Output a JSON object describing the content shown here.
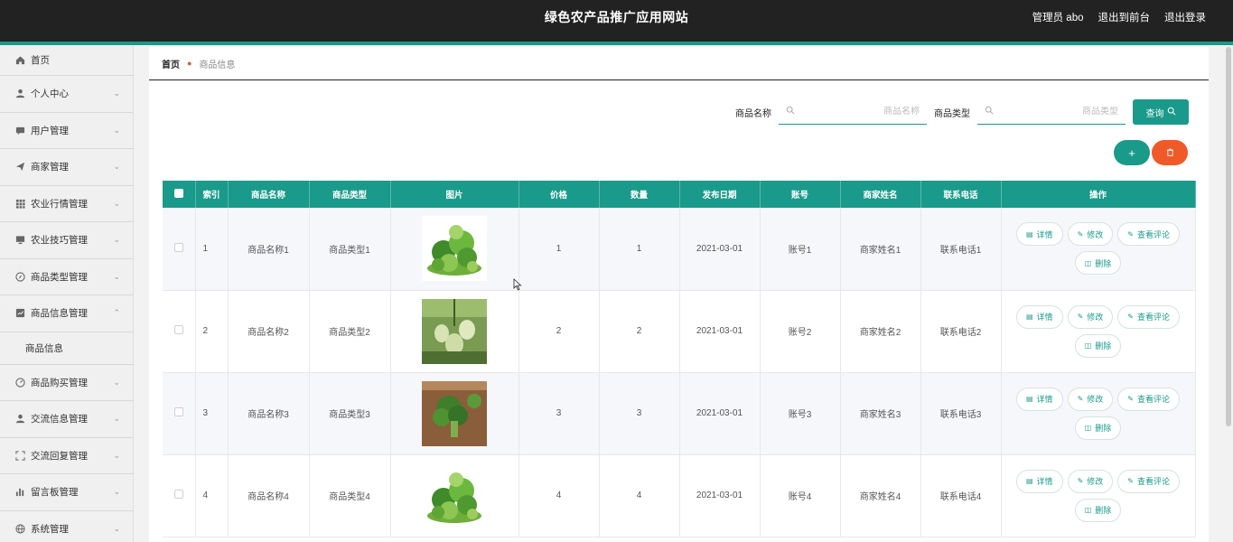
{
  "header": {
    "title": "绿色农产品推广应用网站",
    "admin_label": "管理员 abo",
    "to_front_label": "退出到前台",
    "logout_label": "退出登录"
  },
  "sidebar": {
    "items": [
      {
        "label": "首页",
        "icon": "home-icon"
      },
      {
        "label": "个人中心",
        "icon": "user-icon"
      },
      {
        "label": "用户管理",
        "icon": "chat-icon"
      },
      {
        "label": "商家管理",
        "icon": "send-icon"
      },
      {
        "label": "农业行情管理",
        "icon": "grid-icon"
      },
      {
        "label": "农业技巧管理",
        "icon": "monitor-icon"
      },
      {
        "label": "商品类型管理",
        "icon": "compass-icon"
      },
      {
        "label": "商品信息管理",
        "icon": "chart-icon"
      },
      {
        "label": "商品购买管理",
        "icon": "gauge-icon"
      },
      {
        "label": "交流信息管理",
        "icon": "user-icon"
      },
      {
        "label": "交流回复管理",
        "icon": "frame-icon"
      },
      {
        "label": "留言板管理",
        "icon": "bar-chart-icon"
      },
      {
        "label": "系统管理",
        "icon": "globe-icon"
      }
    ],
    "sub_item": "商品信息"
  },
  "breadcrumb": {
    "home": "首页",
    "current": "商品信息"
  },
  "search": {
    "name_label": "商品名称",
    "name_placeholder": "商品名称",
    "type_label": "商品类型",
    "type_placeholder": "商品类型",
    "query_label": "查询"
  },
  "actions": {
    "add_symbol": "+",
    "delete_symbol": "🗑"
  },
  "table": {
    "headers": [
      "索引",
      "商品名称",
      "商品类型",
      "图片",
      "价格",
      "数量",
      "发布日期",
      "账号",
      "商家姓名",
      "联系电话",
      "操作"
    ],
    "rows": [
      {
        "index": "1",
        "name": "商品名称1",
        "type": "商品类型1",
        "price": "1",
        "qty": "1",
        "date": "2021-03-01",
        "account": "账号1",
        "merchant": "商家姓名1",
        "phone": "联系电话1"
      },
      {
        "index": "2",
        "name": "商品名称2",
        "type": "商品类型2",
        "price": "2",
        "qty": "2",
        "date": "2021-03-01",
        "account": "账号2",
        "merchant": "商家姓名2",
        "phone": "联系电话2"
      },
      {
        "index": "3",
        "name": "商品名称3",
        "type": "商品类型3",
        "price": "3",
        "qty": "3",
        "date": "2021-03-01",
        "account": "账号3",
        "merchant": "商家姓名3",
        "phone": "联系电话3"
      },
      {
        "index": "4",
        "name": "商品名称4",
        "type": "商品类型4",
        "price": "4",
        "qty": "4",
        "date": "2021-03-01",
        "account": "账号4",
        "merchant": "商家姓名4",
        "phone": "联系电话4"
      }
    ],
    "ops": {
      "detail": "详情",
      "edit": "修改",
      "comments": "查看评论",
      "delete": "删除"
    }
  },
  "colors": {
    "accent": "#1a9a8a",
    "danger": "#f05a28",
    "topbar": "#222222"
  }
}
